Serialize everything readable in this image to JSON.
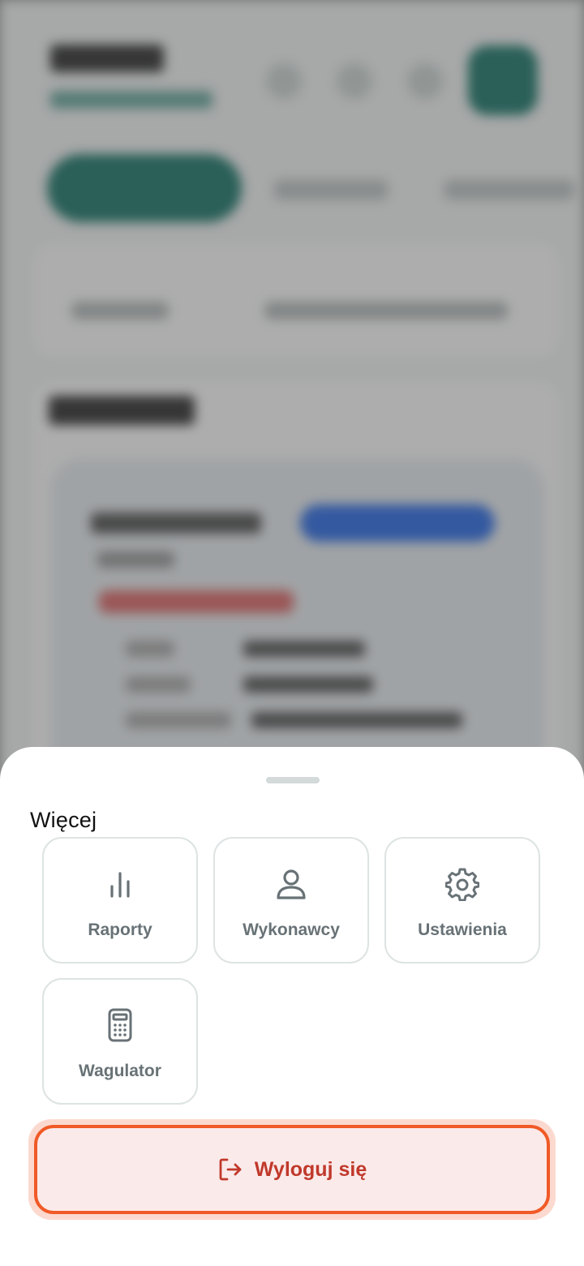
{
  "sheet": {
    "title": "Więcej",
    "tiles": [
      {
        "label": "Raporty",
        "icon": "bar-chart-icon"
      },
      {
        "label": "Wykonawcy",
        "icon": "user-icon"
      },
      {
        "label": "Ustawienia",
        "icon": "gear-icon"
      },
      {
        "label": "Wagulator",
        "icon": "calculator-icon"
      }
    ],
    "logout": {
      "label": "Wyloguj się",
      "icon": "logout-icon"
    }
  },
  "colors": {
    "accent": "#1e7a6d",
    "tile_text": "#687276",
    "logout_text": "#c0392b",
    "logout_border": "#f05a26",
    "logout_bg": "#fbeaea"
  }
}
